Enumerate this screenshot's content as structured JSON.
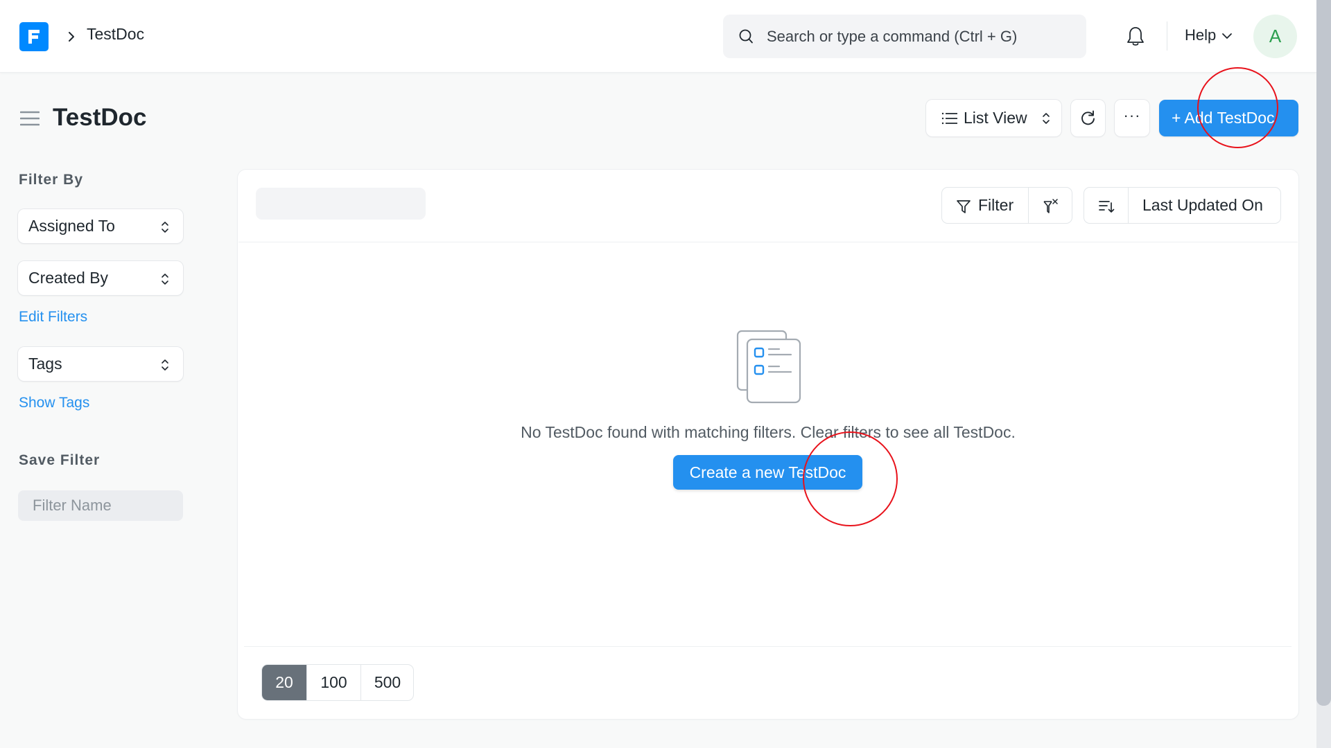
{
  "navbar": {
    "logo_icon": "frappe-logo-icon",
    "breadcrumb_separator_icon": "chevron-right-icon",
    "breadcrumb": "TestDoc",
    "search_placeholder": "Search or type a command (Ctrl + G)",
    "search_icon": "search-icon",
    "notifications_icon": "bell-icon",
    "help_label": "Help",
    "help_icon": "chevron-down-icon",
    "avatar_initial": "A",
    "avatar_colors": {
      "background": "#e8f5ec",
      "text": "#2d9f4f"
    }
  },
  "page_header": {
    "menu_icon": "hamburger-icon",
    "title": "TestDoc",
    "view_switcher": {
      "icon": "list-icon",
      "label": "List View",
      "toggle_icon": "up-down-chevron-icon"
    },
    "refresh_icon": "refresh-icon",
    "more_label": "···",
    "primary_action": "+ Add TestDoc"
  },
  "sidebar": {
    "filter_by_heading": "Filter By",
    "filters": [
      {
        "label": "Assigned To"
      },
      {
        "label": "Created By"
      }
    ],
    "edit_filters_link": "Edit Filters",
    "tags_select": "Tags",
    "show_tags_link": "Show Tags",
    "save_filter_heading": "Save Filter",
    "filter_name_placeholder": "Filter Name"
  },
  "list": {
    "filter_label": "Filter",
    "filter_icon": "funnel-icon",
    "clear_filter_icon": "funnel-x-icon",
    "sort_direction_icon": "sort-descending-icon",
    "sort_field": "Last Updated On",
    "empty_state_icon": "empty-list-icon",
    "empty_message": "No TestDoc found with matching filters. Clear filters to see all TestDoc.",
    "create_button": "Create a new TestDoc",
    "page_sizes": [
      "20",
      "100",
      "500"
    ],
    "active_page_size": "20"
  },
  "colors": {
    "primary": "#2490ef",
    "logo": "#0089ff",
    "annotation": "#e8121b"
  }
}
